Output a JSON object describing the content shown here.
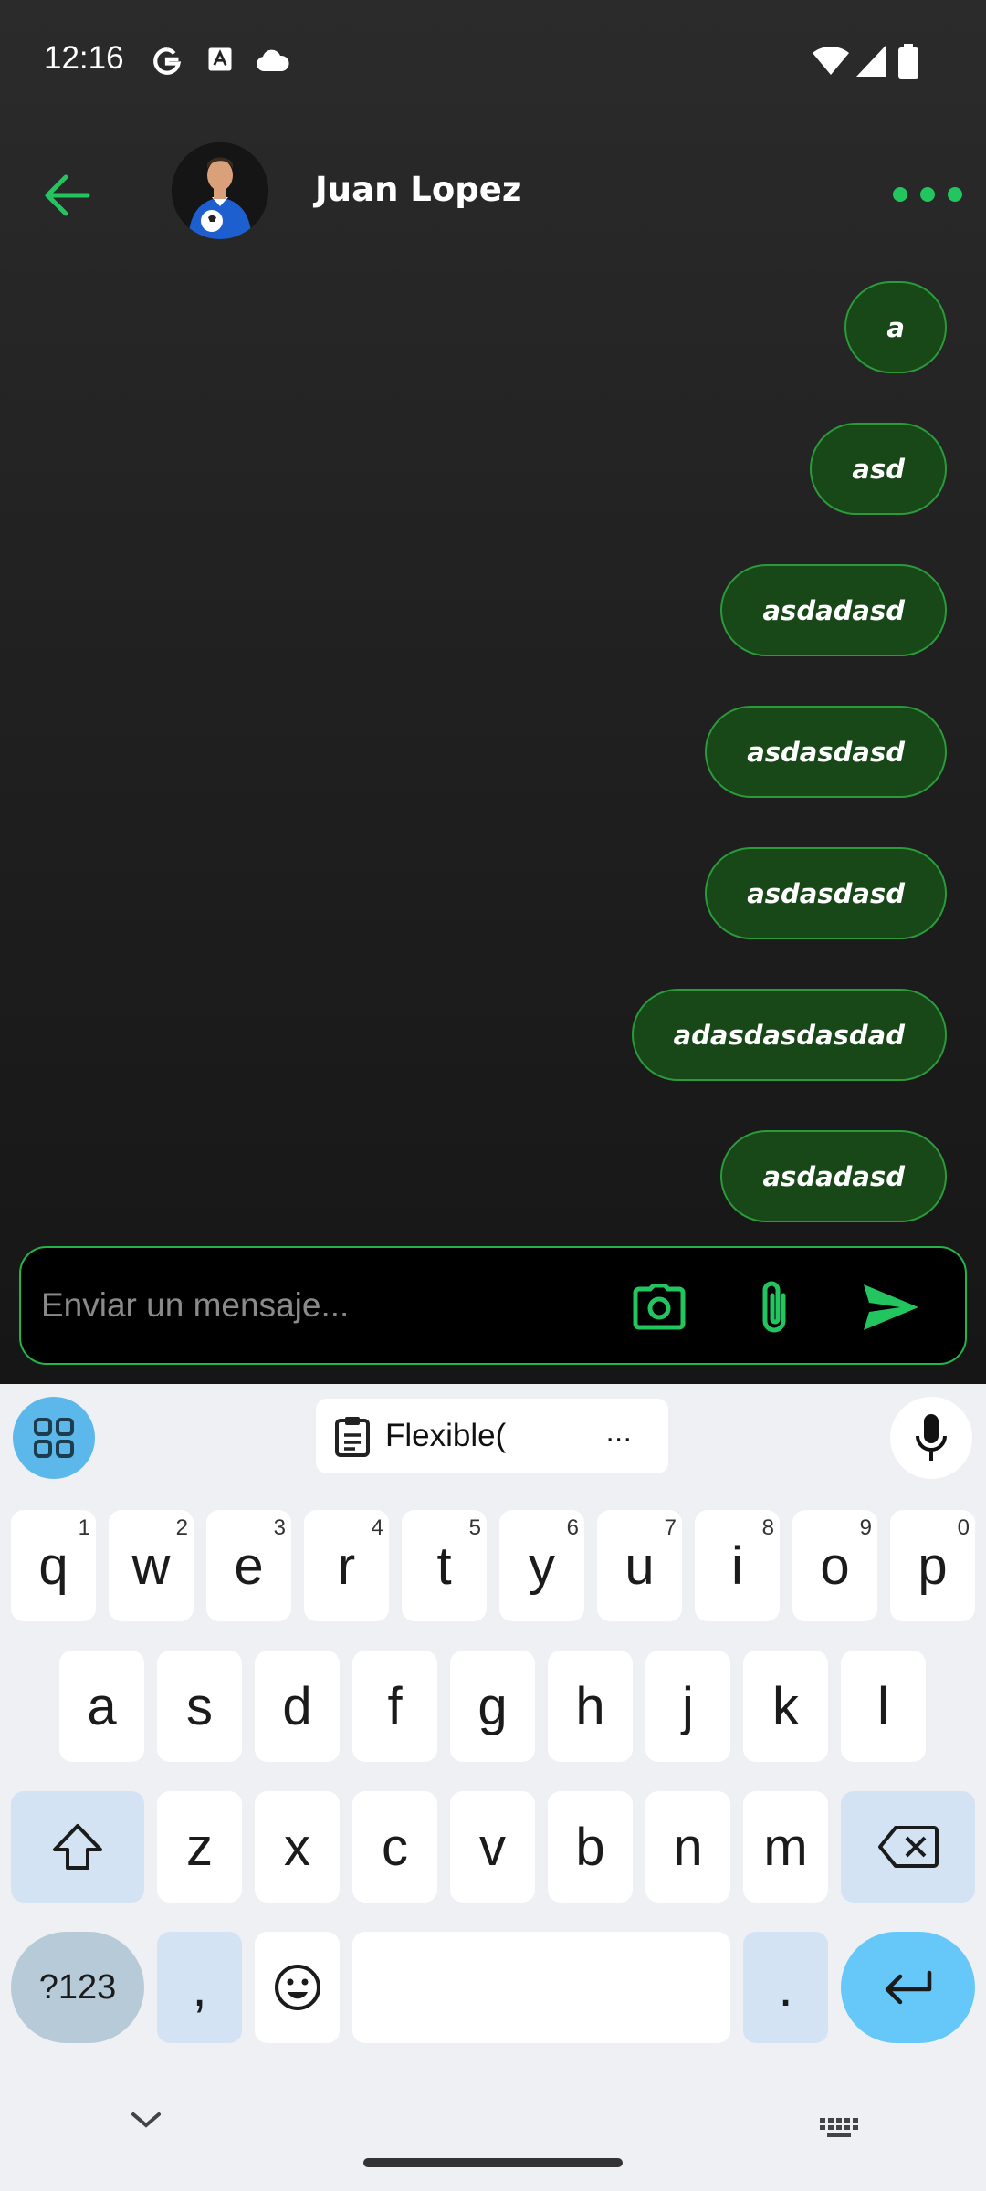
{
  "status_bar": {
    "time": "12:16",
    "left_icons": [
      "google-icon",
      "translate-icon",
      "cloud-icon"
    ],
    "right_icons": [
      "wifi-icon",
      "signal-icon",
      "battery-icon"
    ]
  },
  "header": {
    "contact_name": "Juan Lopez",
    "back_icon": "arrow-left-icon",
    "menu_icon": "more-horizontal-icon",
    "accent_color": "#22c55e"
  },
  "messages": [
    {
      "text": "a"
    },
    {
      "text": "asd"
    },
    {
      "text": "asdadasd"
    },
    {
      "text": "asdasdasd"
    },
    {
      "text": "asdasdasd"
    },
    {
      "text": "adasdasdasdad"
    },
    {
      "text": "asdadasd"
    }
  ],
  "composer": {
    "placeholder": "Enviar un mensaje...",
    "value": "",
    "buttons": [
      "camera-icon",
      "attach-icon",
      "send-icon"
    ]
  },
  "keyboard": {
    "clipboard_text": "Flexible(",
    "clipboard_more": "...",
    "row1": [
      {
        "key": "q",
        "hint": "1"
      },
      {
        "key": "w",
        "hint": "2"
      },
      {
        "key": "e",
        "hint": "3"
      },
      {
        "key": "r",
        "hint": "4"
      },
      {
        "key": "t",
        "hint": "5"
      },
      {
        "key": "y",
        "hint": "6"
      },
      {
        "key": "u",
        "hint": "7"
      },
      {
        "key": "i",
        "hint": "8"
      },
      {
        "key": "o",
        "hint": "9"
      },
      {
        "key": "p",
        "hint": "0"
      }
    ],
    "row2": [
      "a",
      "s",
      "d",
      "f",
      "g",
      "h",
      "j",
      "k",
      "l"
    ],
    "row3": [
      "z",
      "x",
      "c",
      "v",
      "b",
      "n",
      "m"
    ],
    "symbols_label": "?123",
    "comma": ",",
    "period": "."
  }
}
